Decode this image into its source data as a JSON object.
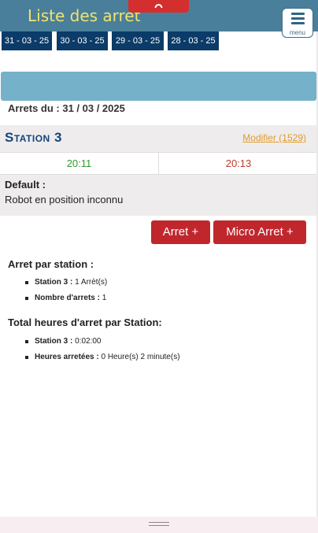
{
  "header": {
    "title": "Liste des arret",
    "menu_label": "menu"
  },
  "date_tabs": [
    "31 - 03 - 25",
    "30 - 03 - 25",
    "29 - 03 - 25",
    "28 - 03 - 25"
  ],
  "arrets_du": "Arrets du : 31 / 03 / 2025",
  "station": {
    "name": "Station 3",
    "modifier_link": "Modifier (1529)",
    "start_time": "20:11",
    "end_time": "20:13",
    "default_label": "Default :",
    "default_text": "Robot en position inconnu"
  },
  "buttons": {
    "arret": "Arret +",
    "micro_arret": "Micro Arret +"
  },
  "arret_par_station": {
    "title": "Arret par station :",
    "items": [
      {
        "label": "Station 3 :",
        "value": "1 Arrèt(s)"
      },
      {
        "label": "Nombre d'arrets :",
        "value": "1"
      }
    ]
  },
  "total_heures": {
    "title": "Total heures d'arret par Station:",
    "items": [
      {
        "label": "Station 3 :",
        "value": "0:02:00"
      },
      {
        "label": "Heures arretées :",
        "value": "0 Heure(s) 2 minute(s)"
      }
    ]
  },
  "colors": {
    "header_bg": "#4a7f9b",
    "title": "#f2e36b",
    "tab_bg": "#0b3b68",
    "accent_red": "#c0272d",
    "station_name": "#14457a",
    "link": "#e29a28",
    "start_time": "#2f9a2f",
    "end_time": "#c0392b"
  },
  "icons": {
    "top_pull": "chevron-up-icon",
    "menu": "hamburger-icon"
  }
}
